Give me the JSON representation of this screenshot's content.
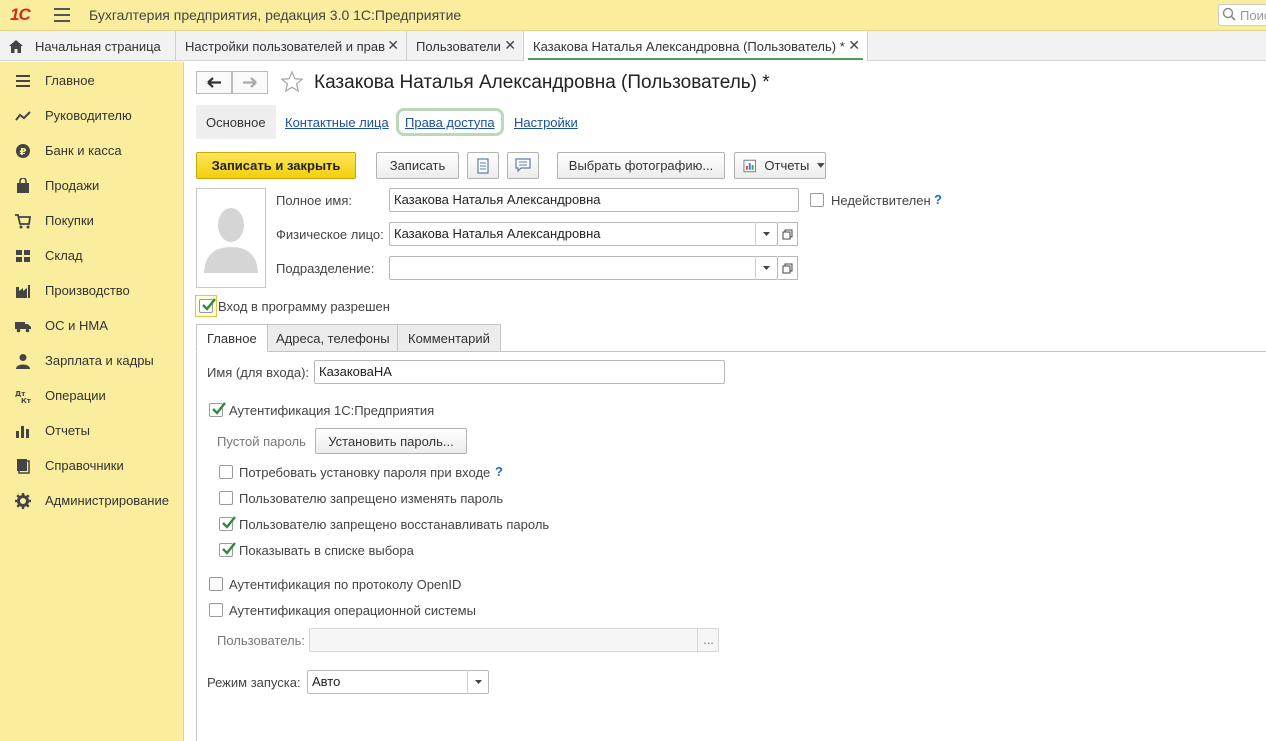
{
  "app": {
    "logo": "1С",
    "title": "Бухгалтерия предприятия, редакция 3.0 1С:Предприятие",
    "search_placeholder": "Поиск"
  },
  "tabs": [
    {
      "label": "Начальная страница",
      "icon": "home-icon"
    },
    {
      "label": "Настройки пользователей и прав",
      "close": "✕"
    },
    {
      "label": "Пользователи",
      "close": "✕"
    },
    {
      "label": "Казакова Наталья Александровна (Пользователь) *",
      "close": "✕"
    }
  ],
  "sidebar": {
    "items": [
      {
        "label": "Главное",
        "icon": "menu-lines-icon"
      },
      {
        "label": "Руководителю",
        "icon": "trend-chart-icon"
      },
      {
        "label": "Банк и касса",
        "icon": "ruble-coin-icon"
      },
      {
        "label": "Продажи",
        "icon": "shopping-bag-icon"
      },
      {
        "label": "Покупки",
        "icon": "shopping-cart-icon"
      },
      {
        "label": "Склад",
        "icon": "warehouse-grid-icon"
      },
      {
        "label": "Производство",
        "icon": "factory-icon"
      },
      {
        "label": "ОС и НМА",
        "icon": "truck-icon"
      },
      {
        "label": "Зарплата и кадры",
        "icon": "person-icon"
      },
      {
        "label": "Операции",
        "icon": "debit-credit-icon"
      },
      {
        "label": "Отчеты",
        "icon": "bar-chart-icon"
      },
      {
        "label": "Справочники",
        "icon": "books-icon"
      },
      {
        "label": "Администрирование",
        "icon": "gear-icon"
      }
    ]
  },
  "form": {
    "title": "Казакова Наталья Александровна (Пользователь) *",
    "tabs": [
      "Основное",
      "Контактные лица",
      "Права доступа",
      "Настройки"
    ],
    "toolbar": {
      "save_close": "Записать и закрыть",
      "save": "Записать",
      "choose_photo": "Выбрать фотографию...",
      "reports": "Отчеты"
    },
    "full_name_label": "Полное имя:",
    "full_name_value": "Казакова Наталья Александровна",
    "invalid_label": "Недействителен",
    "person_label": "Физическое лицо:",
    "person_value": "Казакова Наталья Александровна",
    "department_label": "Подразделение:",
    "department_value": "",
    "login_allowed_label": "Вход в программу разрешен",
    "help": "?",
    "inner_tabs": [
      "Главное",
      "Адреса, телефоны",
      "Комментарий"
    ],
    "login_name_label": "Имя (для входа):",
    "login_name_value": "КазаковаНА",
    "auth_1c_label": "Аутентификация 1С:Предприятия",
    "empty_password_label": "Пустой пароль",
    "set_password_button": "Установить пароль...",
    "require_password_label": "Потребовать установку пароля при входе",
    "forbid_change_label": "Пользователю запрещено изменять пароль",
    "forbid_restore_label": "Пользователю запрещено восстанавливать пароль",
    "show_in_list_label": "Показывать в списке выбора",
    "openid_label": "Аутентификация по протоколу OpenID",
    "os_auth_label": "Аутентификация операционной системы",
    "os_user_label": "Пользователь:",
    "os_user_value": "",
    "ellipsis": "...",
    "launch_mode_label": "Режим запуска:",
    "launch_mode_value": "Авто"
  },
  "checkbox_state": {
    "invalid": false,
    "login_allowed": true,
    "auth_1c": true,
    "require_password": false,
    "forbid_change": false,
    "forbid_restore": true,
    "show_in_list": true,
    "openid": false,
    "os_auth": false
  },
  "colors": {
    "sidebar_bg": "#fbed9e",
    "primary_button": "#f7d51d",
    "link": "#1a4f9c",
    "check": "#2f8a3b",
    "active_tab_underline": "#4aa05a"
  }
}
